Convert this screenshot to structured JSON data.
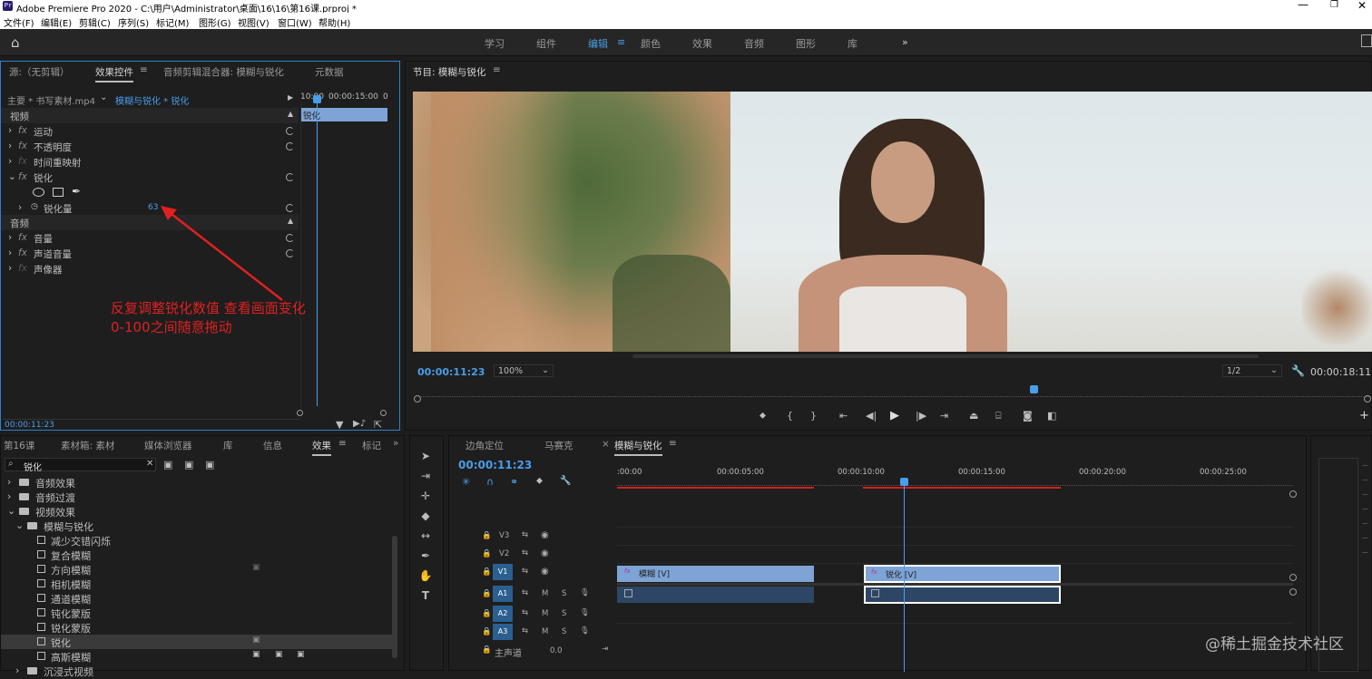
{
  "window": {
    "title": "Adobe Premiere Pro 2020 - C:\\用户\\Administrator\\桌面\\16\\16\\第16课.prproj *"
  },
  "menu": [
    "文件(F)",
    "编辑(E)",
    "剪辑(C)",
    "序列(S)",
    "标记(M)",
    "图形(G)",
    "视图(V)",
    "窗口(W)",
    "帮助(H)"
  ],
  "workspaces": [
    "学习",
    "组件",
    "编辑",
    "颜色",
    "效果",
    "音频",
    "图形",
    "库"
  ],
  "effect_controls": {
    "tabs": [
      "源:（无剪辑）",
      "效果控件",
      "音频剪辑混合器: 模糊与锐化",
      "元数据"
    ],
    "clip_path": "主要 * 书写素材.mp4",
    "seq_path": "模糊与锐化 * 锐化",
    "ruler_start": "10:00",
    "ruler_mid": "00:00:15:00",
    "ruler_end": "0",
    "clip_bar": "锐化",
    "video_header": "视频",
    "audio_header": "音频",
    "rows": [
      "运动",
      "不透明度",
      "时间重映射",
      "锐化"
    ],
    "param_label": "锐化量",
    "param_value": "63",
    "audio_rows": [
      "音量",
      "声道音量",
      "声像器"
    ],
    "time": "00:00:11:23"
  },
  "annotation": {
    "line1": "反复调整锐化数值 查看画面变化",
    "line2": "0-100之间随意拖动"
  },
  "program": {
    "title": "节目: 模糊与锐化",
    "timecode": "00:00:11:23",
    "zoom": "100%",
    "quality": "1/2",
    "duration": "00:00:18:11"
  },
  "effects_panel": {
    "tabs": [
      "第16课",
      "素材箱: 素材",
      "媒体浏览器",
      "库",
      "信息",
      "效果",
      "标记"
    ],
    "search": "锐化",
    "tree": [
      "音频效果",
      "音频过渡",
      "视频效果",
      "模糊与锐化",
      "减少交错闪烁",
      "复合模糊",
      "方向模糊",
      "相机模糊",
      "通道模糊",
      "钝化蒙版",
      "锐化蒙版",
      "锐化",
      "高斯模糊",
      "沉浸式视频"
    ]
  },
  "timeline": {
    "tabs": [
      "边角定位",
      "马赛克",
      "模糊与锐化"
    ],
    "timecode": "00:00:11:23",
    "ruler": [
      ":00:00",
      "00:00:05:00",
      "00:00:10:00",
      "00:00:15:00",
      "00:00:20:00",
      "00:00:25:00"
    ],
    "video_tracks": [
      "V3",
      "V2",
      "V1"
    ],
    "audio_tracks": [
      "A1",
      "A2",
      "A3"
    ],
    "master": "主声道",
    "master_val": "0.0",
    "clip1": "模糊 [V]",
    "clip2": "锐化 [V]"
  },
  "watermark": "@稀土掘金技术社区",
  "colors": {
    "accent": "#4a9de8",
    "annotation": "#e02020",
    "clip": "#7ea4d6"
  }
}
